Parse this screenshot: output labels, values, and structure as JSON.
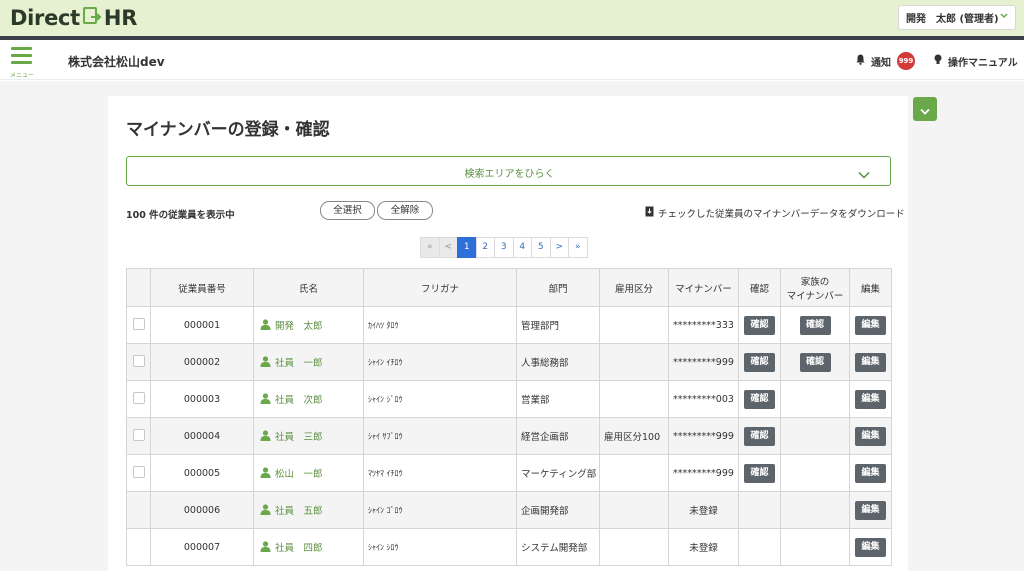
{
  "app": {
    "logo_left": "Direct",
    "logo_right": "HR",
    "user_menu": "開発　太郎 (管理者)",
    "menu_label": "メニュー",
    "company": "株式会社松山dev",
    "notice_label": "通知",
    "notice_count": "999",
    "manual_label": "操作マニュアル",
    "accent": "#6aa94a"
  },
  "page": {
    "title": "マイナンバーの登録・確認",
    "search_toggle": "検索エリアをひらく",
    "count_text": "100 件の従業員を表示中",
    "select_all": "全選択",
    "deselect_all": "全解除",
    "download": "チェックした従業員のマイナンバーデータをダウンロード"
  },
  "pager": [
    "«",
    "<",
    "1",
    "2",
    "3",
    "4",
    "5",
    ">",
    "»"
  ],
  "table": {
    "headers": {
      "emp_no": "従業員番号",
      "name": "氏名",
      "kana": "フリガナ",
      "dept": "部門",
      "employment": "雇用区分",
      "mynumber": "マイナンバー",
      "confirm": "確認",
      "family_line1": "家族の",
      "family_line2": "マイナンバー",
      "edit": "編集"
    },
    "confirm_label": "確認",
    "edit_label": "編集",
    "rows": [
      {
        "emp_no": "000001",
        "name": "開発　太郎",
        "kana": "ｶｲﾊﾂ ﾀﾛｳ",
        "dept": "管理部門",
        "employment": "",
        "mynumber": "*********333",
        "checkbox": true,
        "confirm": true,
        "family": true
      },
      {
        "emp_no": "000002",
        "name": "社員　一郎",
        "kana": "ｼｬｲﾝ ｲﾁﾛｳ",
        "dept": "人事総務部",
        "employment": "",
        "mynumber": "*********999",
        "checkbox": true,
        "confirm": true,
        "family": true
      },
      {
        "emp_no": "000003",
        "name": "社員　次郎",
        "kana": "ｼｬｲﾝ ｼﾞﾛｳ",
        "dept": "営業部",
        "employment": "",
        "mynumber": "*********003",
        "checkbox": true,
        "confirm": true,
        "family": false
      },
      {
        "emp_no": "000004",
        "name": "社員　三郎",
        "kana": "ｼｬｲ ｻﾌﾞﾛｳ",
        "dept": "経営企画部",
        "employment": "雇用区分100",
        "mynumber": "*********999",
        "checkbox": true,
        "confirm": true,
        "family": false
      },
      {
        "emp_no": "000005",
        "name": "松山　一郎",
        "kana": "ﾏﾂﾔﾏ ｲﾁﾛｳ",
        "dept": "マーケティング部",
        "employment": "",
        "mynumber": "*********999",
        "checkbox": true,
        "confirm": true,
        "family": false
      },
      {
        "emp_no": "000006",
        "name": "社員　五郎",
        "kana": "ｼｬｲﾝ ｺﾞﾛｳ",
        "dept": "企画開発部",
        "employment": "",
        "mynumber": "未登録",
        "checkbox": false,
        "confirm": false,
        "family": false
      },
      {
        "emp_no": "000007",
        "name": "社員　四郎",
        "kana": "ｼｬｲﾝ ｼﾛｳ",
        "dept": "システム開発部",
        "employment": "",
        "mynumber": "未登録",
        "checkbox": false,
        "confirm": false,
        "family": false
      }
    ]
  }
}
